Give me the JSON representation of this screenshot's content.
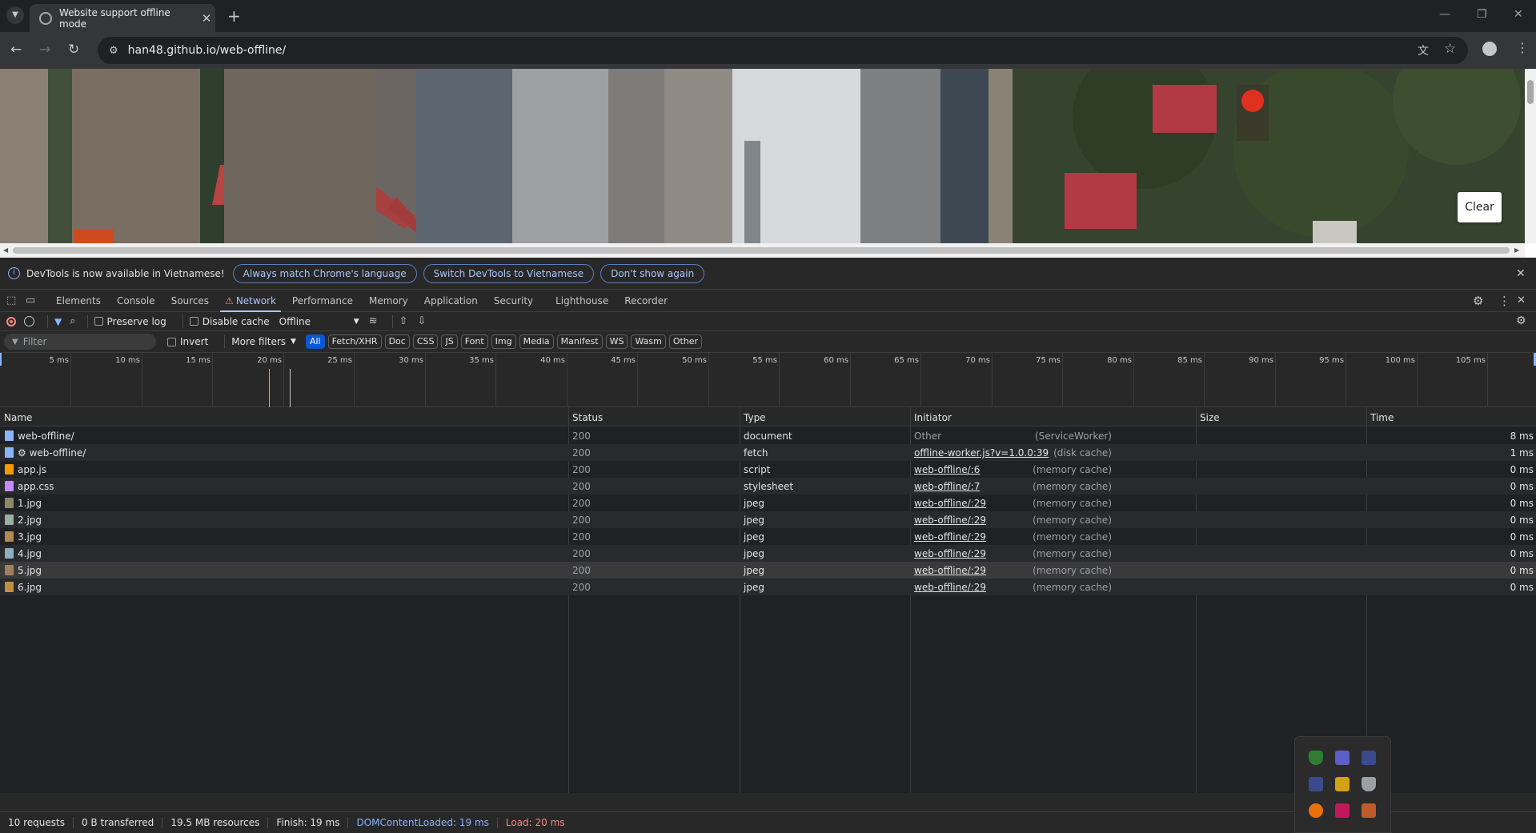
{
  "browser": {
    "tab_title": "Website support offline mode",
    "new_tab_label": "+",
    "url": "han48.github.io/web-offline/"
  },
  "page": {
    "clear_label": "Clear"
  },
  "devtools": {
    "infobar": {
      "text": "DevTools is now available in Vietnamese!",
      "btn_match": "Always match Chrome's language",
      "btn_switch": "Switch DevTools to Vietnamese",
      "btn_dont_show": "Don't show again"
    },
    "tabs": [
      "Elements",
      "Console",
      "Sources",
      "Network",
      "Performance",
      "Memory",
      "Application",
      "Security",
      "Lighthouse",
      "Recorder"
    ],
    "active_tab": "Network",
    "toolbar": {
      "preserve_log": "Preserve log",
      "disable_cache": "Disable cache",
      "throttle": "Offline"
    },
    "filter": {
      "placeholder": "Filter",
      "invert": "Invert",
      "more_filters": "More filters",
      "chips": [
        "All",
        "Fetch/XHR",
        "Doc",
        "CSS",
        "JS",
        "Font",
        "Img",
        "Media",
        "Manifest",
        "WS",
        "Wasm",
        "Other"
      ],
      "active_chip": "All"
    },
    "timeline_ticks": [
      "5 ms",
      "10 ms",
      "15 ms",
      "20 ms",
      "25 ms",
      "30 ms",
      "35 ms",
      "40 ms",
      "45 ms",
      "50 ms",
      "55 ms",
      "60 ms",
      "65 ms",
      "70 ms",
      "75 ms",
      "80 ms",
      "85 ms",
      "90 ms",
      "95 ms",
      "100 ms",
      "105 ms"
    ],
    "columns": {
      "name": "Name",
      "status": "Status",
      "type": "Type",
      "initiator": "Initiator",
      "size": "Size",
      "time": "Time"
    },
    "requests": [
      {
        "name": "web-offline/",
        "status": "200",
        "type": "document",
        "initiator": "Other",
        "size": "(ServiceWorker)",
        "time": "8 ms",
        "icon_color": "#8ab4f8"
      },
      {
        "name": "⚙ web-offline/",
        "status": "200",
        "type": "fetch",
        "initiator": "offline-worker.js?v=1.0.0:39",
        "size": "(disk cache)",
        "time": "1 ms",
        "icon_color": "#8ab4f8"
      },
      {
        "name": "app.js",
        "status": "200",
        "type": "script",
        "initiator": "web-offline/:6",
        "size": "(memory cache)",
        "time": "0 ms",
        "icon_color": "#f29900"
      },
      {
        "name": "app.css",
        "status": "200",
        "type": "stylesheet",
        "initiator": "web-offline/:7",
        "size": "(memory cache)",
        "time": "0 ms",
        "icon_color": "#c58af9"
      },
      {
        "name": "1.jpg",
        "status": "200",
        "type": "jpeg",
        "initiator": "web-offline/:29",
        "size": "(memory cache)",
        "time": "0 ms",
        "icon_color": "#8a8a6a"
      },
      {
        "name": "2.jpg",
        "status": "200",
        "type": "jpeg",
        "initiator": "web-offline/:29",
        "size": "(memory cache)",
        "time": "0 ms",
        "icon_color": "#9ab0a0"
      },
      {
        "name": "3.jpg",
        "status": "200",
        "type": "jpeg",
        "initiator": "web-offline/:29",
        "size": "(memory cache)",
        "time": "0 ms",
        "icon_color": "#b08a50"
      },
      {
        "name": "4.jpg",
        "status": "200",
        "type": "jpeg",
        "initiator": "web-offline/:29",
        "size": "(memory cache)",
        "time": "0 ms",
        "icon_color": "#8ab0c0"
      },
      {
        "name": "5.jpg",
        "status": "200",
        "type": "jpeg",
        "initiator": "web-offline/:29",
        "size": "(memory cache)",
        "time": "0 ms",
        "icon_color": "#a08060"
      },
      {
        "name": "6.jpg",
        "status": "200",
        "type": "jpeg",
        "initiator": "web-offline/:29",
        "size": "(memory cache)",
        "time": "0 ms",
        "icon_color": "#c09040"
      }
    ],
    "status_bar": {
      "requests": "10 requests",
      "transferred": "0 B transferred",
      "resources": "19.5 MB resources",
      "finish": "Finish: 19 ms",
      "dcl": "DOMContentLoaded: 19 ms",
      "load": "Load: 20 ms"
    }
  }
}
